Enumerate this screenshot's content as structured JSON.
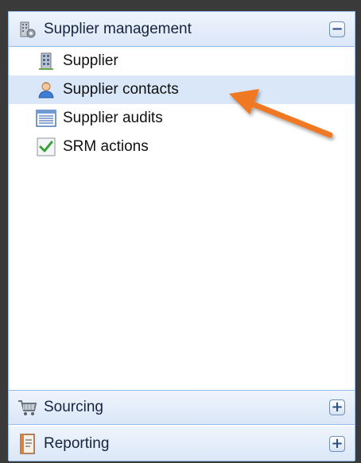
{
  "panel": {
    "supplier_management": {
      "title": "Supplier management",
      "toggle": "−",
      "items": [
        {
          "label": "Supplier",
          "icon": "building-icon"
        },
        {
          "label": "Supplier contacts",
          "icon": "contact-person-icon"
        },
        {
          "label": "Supplier audits",
          "icon": "list-icon"
        },
        {
          "label": "SRM actions",
          "icon": "checkmark-icon"
        }
      ]
    },
    "sourcing": {
      "title": "Sourcing",
      "toggle": "+"
    },
    "reporting": {
      "title": "Reporting",
      "toggle": "+"
    }
  },
  "colors": {
    "selected_row": "#d9e7f8",
    "header_border": "#99bbe8",
    "annotation_arrow": "#f07820"
  }
}
